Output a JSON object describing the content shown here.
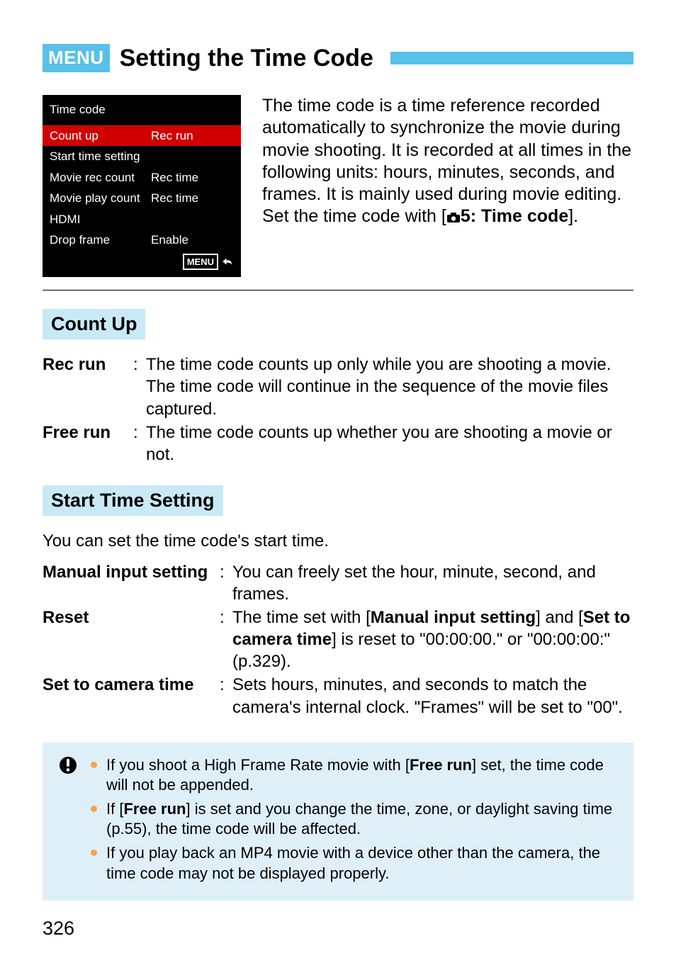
{
  "header": {
    "menu_badge": "MENU",
    "title": "Setting the Time Code"
  },
  "camera_screenshot": {
    "title": "Time code",
    "rows": [
      {
        "label": "Count up",
        "value": "Rec run",
        "selected": true
      },
      {
        "label": "Start time setting",
        "value": "",
        "selected": false
      },
      {
        "label": "Movie rec count",
        "value": "Rec time",
        "selected": false
      },
      {
        "label": "Movie play count",
        "value": "Rec time",
        "selected": false
      },
      {
        "label": "HDMI",
        "value": "",
        "selected": false
      },
      {
        "label": "Drop frame",
        "value": "Enable",
        "selected": false
      }
    ],
    "footer_label": "MENU"
  },
  "intro": {
    "p1": "The time code is a time reference recorded automatically to synchronize the movie during movie shooting. It is recorded at all times in the following units: hours, minutes, seconds, and frames. It is mainly used during movie editing.",
    "p2_a": "Set the time code with [",
    "p2_menu": "5: Time code",
    "p2_b": "]."
  },
  "sections": {
    "count_up": {
      "label": "Count Up",
      "items": [
        {
          "term": "Rec run",
          "desc": "The time code counts up only while you are shooting a movie. The time code will continue in the sequence of the movie files captured."
        },
        {
          "term": "Free run",
          "desc": "The time code counts up whether you are shooting a movie or not."
        }
      ]
    },
    "start_time": {
      "label": "Start Time Setting",
      "intro": "You can set the time code's start time.",
      "items": [
        {
          "term": "Manual input setting",
          "desc_plain": "You can freely set the hour, minute, second, and frames."
        },
        {
          "term": "Reset",
          "desc_a": "The time set with [",
          "desc_b1": "Manual input setting",
          "desc_c": "] and [",
          "desc_b2": "Set to camera time",
          "desc_d": "] is reset to \"00:00:00.\" or \"00:00:00:\" (p.329)."
        },
        {
          "term": "Set to camera time",
          "desc_plain": "Sets hours, minutes, and seconds to match the camera's internal clock. \"Frames\" will be set to \"00\"."
        }
      ]
    }
  },
  "notes": [
    {
      "a": "If you shoot a High Frame Rate movie with [",
      "b": "Free run",
      "c": "] set, the time code will not be appended."
    },
    {
      "a": "If [",
      "b": "Free run",
      "c": "] is set and you change the time, zone, or daylight saving time (p.55), the time code will be affected."
    },
    {
      "plain": "If you play back an MP4 movie with a device other than the camera, the time code may not be displayed properly."
    }
  ],
  "page_number": "326"
}
